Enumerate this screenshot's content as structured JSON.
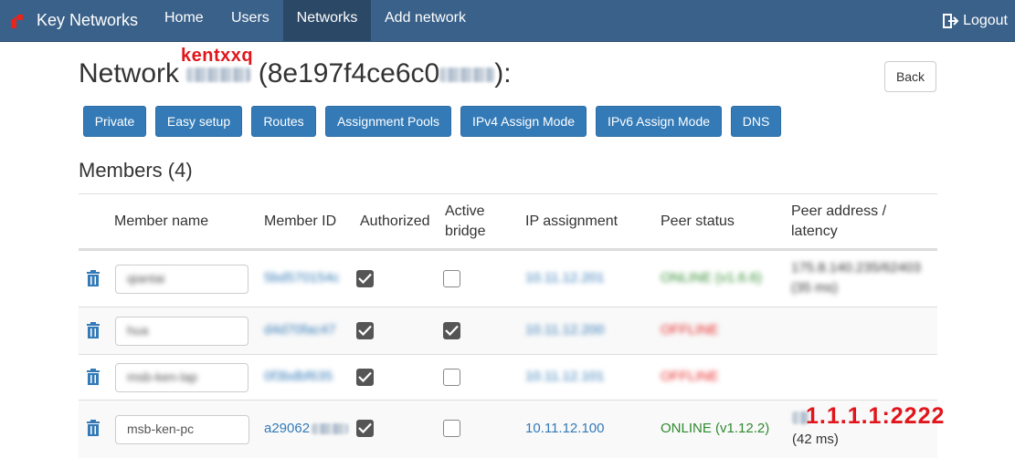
{
  "navbar": {
    "brand": "Key Networks",
    "items": [
      "Home",
      "Users",
      "Networks",
      "Add network"
    ],
    "active_index": 2,
    "logout": "Logout"
  },
  "header": {
    "title_prefix": "Network",
    "title_id": "(8e197f4ce6c0",
    "title_suffix": "):",
    "overlay_label": "kentxxq",
    "back": "Back"
  },
  "toolbar": [
    "Private",
    "Easy setup",
    "Routes",
    "Assignment Pools",
    "IPv4 Assign Mode",
    "IPv6 Assign Mode",
    "DNS"
  ],
  "members": {
    "heading": "Members (4)",
    "columns": {
      "name": "Member name",
      "id": "Member ID",
      "authorized": "Authorized",
      "bridge_1": "Active",
      "bridge_2": "bridge",
      "ip": "IP assignment",
      "status": "Peer status",
      "addr_1": "Peer address /",
      "addr_2": "latency"
    },
    "rows": [
      {
        "name": "qiantai",
        "id": "5bd570154c",
        "authorized": true,
        "bridge": false,
        "ip": "10.11.12.201",
        "status": "ONLINE (v1.6.6)",
        "status_kind": "online",
        "addr": "175.8.140.235/62403",
        "latency": "(35 ms)"
      },
      {
        "name": "hua",
        "id": "d4d70fac47",
        "authorized": true,
        "bridge": true,
        "ip": "10.11.12.200",
        "status": "OFFLINE",
        "status_kind": "offline",
        "addr": "",
        "latency": ""
      },
      {
        "name": "msb-ken-lap",
        "id": "0f3bdbf635",
        "authorized": true,
        "bridge": false,
        "ip": "10.11.12.101",
        "status": "OFFLINE",
        "status_kind": "offline",
        "addr": "",
        "latency": ""
      },
      {
        "name": "msb-ken-pc",
        "id": "a29062",
        "authorized": true,
        "bridge": false,
        "ip": "10.11.12.100",
        "status": "ONLINE (v1.12.2)",
        "status_kind": "online",
        "addr": "",
        "latency": "(42 ms)"
      }
    ],
    "overlay_addr": "1.1.1.1:2222"
  },
  "colors": {
    "navbar_bg": "#3a6189",
    "primary": "#337ab7",
    "online": "#2e8b2e",
    "offline": "#e82020",
    "annotation_red": "#e0161c"
  },
  "icons": [
    "logo-icon",
    "logout-icon",
    "trash-icon",
    "checkmark-icon"
  ]
}
